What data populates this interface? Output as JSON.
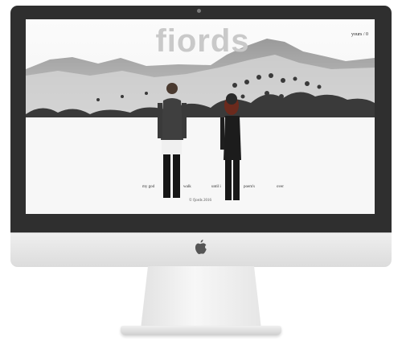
{
  "site": {
    "logo": "fiords",
    "cart_label": "yours / 0",
    "copyright": "© fjords 2016"
  },
  "nav": {
    "items": [
      {
        "label": "my god"
      },
      {
        "label": "walk"
      },
      {
        "label": "until i"
      },
      {
        "label": "poem's"
      },
      {
        "label": "over"
      }
    ]
  },
  "colors": {
    "bezel": "#2f2f2f",
    "chin": "#e6e6e6",
    "logo_text": "#c9c9c9"
  },
  "icons": {
    "monitor_logo": "apple-icon"
  }
}
